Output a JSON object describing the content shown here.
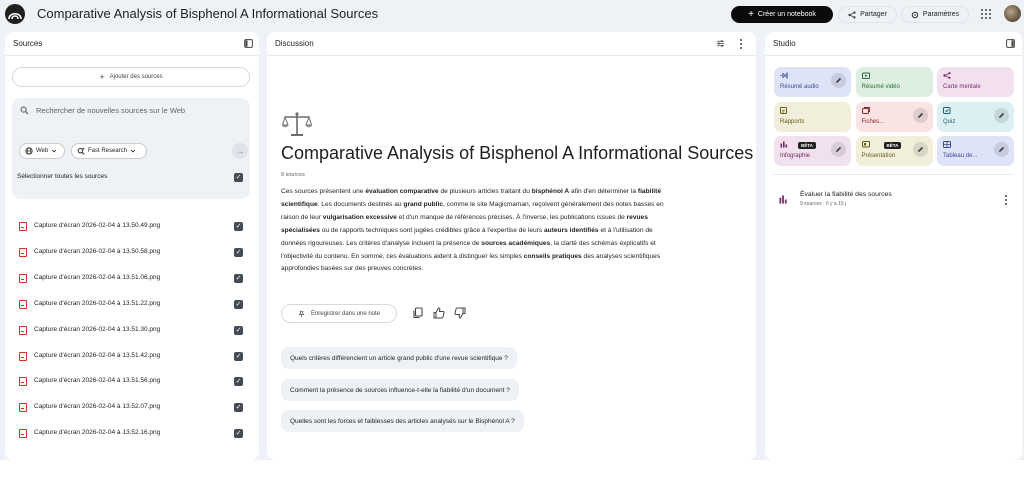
{
  "header": {
    "title": "Comparative Analysis of Bisphenol A Informational Sources",
    "create_label": "Créer un notebook",
    "share_label": "Partager",
    "settings_label": "Paramètres"
  },
  "sources": {
    "title": "Sources",
    "add_label": "Ajouter des sources",
    "search_placeholder": "Rechercher de nouvelles sources sur le Web",
    "chip_web": "Web",
    "chip_research": "Fast Research",
    "select_all_label": "Sélectionner toutes les sources",
    "items": [
      {
        "name": "Capture d'écran 2026-02-04 à 13.50.49.png",
        "checked": true
      },
      {
        "name": "Capture d'écran 2026-02-04 à 13.50.58.png",
        "checked": true
      },
      {
        "name": "Capture d'écran 2026-02-04 à 13.51.06.png",
        "checked": true
      },
      {
        "name": "Capture d'écran 2026-02-04 à 13.51.22.png",
        "checked": true
      },
      {
        "name": "Capture d'écran 2026-02-04 à 13.51.30.png",
        "checked": true
      },
      {
        "name": "Capture d'écran 2026-02-04 à 13.51.42.png",
        "checked": true
      },
      {
        "name": "Capture d'écran 2026-02-04 à 13.51.56.png",
        "checked": true
      },
      {
        "name": "Capture d'écran 2026-02-04 à 13.52.07.png",
        "checked": true
      },
      {
        "name": "Capture d'écran 2026-02-04 à 13.52.16.png",
        "checked": true
      }
    ]
  },
  "discussion": {
    "title": "Discussion",
    "doc_title": "Comparative Analysis of Bisphenol A Informational Sources",
    "source_count": "9 sources",
    "summary_segments": [
      {
        "text": "Ces sources présentent une ",
        "bold": false
      },
      {
        "text": "évaluation comparative",
        "bold": true
      },
      {
        "text": " de plusieurs articles traitant du ",
        "bold": false
      },
      {
        "text": "bisphénol A",
        "bold": true
      },
      {
        "text": " afin d'en déterminer la ",
        "bold": false
      },
      {
        "text": "fiabilité scientifique",
        "bold": true
      },
      {
        "text": ". Les documents destinés au ",
        "bold": false
      },
      {
        "text": "grand public",
        "bold": true
      },
      {
        "text": ", comme le site Magicmaman, reçoivent généralement des notes basses en raison de leur ",
        "bold": false
      },
      {
        "text": "vulgarisation excessive",
        "bold": true
      },
      {
        "text": " et d'un manque de références précises. À l'inverse, les publications issues de ",
        "bold": false
      },
      {
        "text": "revues spécialisées",
        "bold": true
      },
      {
        "text": " ou de rapports techniques sont jugées crédibles grâce à l'expertise de leurs ",
        "bold": false
      },
      {
        "text": "auteurs identifiés",
        "bold": true
      },
      {
        "text": " et à l'utilisation de données rigoureuses. Les critères d'analyse incluent la présence de ",
        "bold": false
      },
      {
        "text": "sources académiques",
        "bold": true
      },
      {
        "text": ", la clarté des schémas explicatifs et l'objectivité du contenu. En somme, ces évaluations aident à distinguer les simples ",
        "bold": false
      },
      {
        "text": "conseils pratiques",
        "bold": true
      },
      {
        "text": " des analyses scientifiques approfondies basées sur des preuves concrètes.",
        "bold": false
      }
    ],
    "save_note_label": "Enregistrer dans une note",
    "suggestions": [
      "Quels critères différencient un article grand public d'une revue scientifique ?",
      "Comment la présence de sources influence-t-elle la fiabilité d'un document ?",
      "Quelles sont les forces et faiblesses des articles analysés sur le Bisphénol A ?"
    ]
  },
  "studio": {
    "title": "Studio",
    "tiles": [
      {
        "label": "Résumé audio",
        "bg": "#dfe3f7",
        "fg": "#3b4a9c",
        "icon": "waveform-icon",
        "edit": true,
        "beta": false
      },
      {
        "label": "Résumé vidéo",
        "bg": "#dcefe0",
        "fg": "#2e6b3a",
        "icon": "video-icon",
        "edit": false,
        "beta": false
      },
      {
        "label": "Carte mentale",
        "bg": "#f2e0ee",
        "fg": "#7a2f6a",
        "icon": "mindmap-icon",
        "edit": false,
        "beta": false
      },
      {
        "label": "Rapports",
        "bg": "#f1eedc",
        "fg": "#6b5a14",
        "icon": "report-icon",
        "edit": false,
        "beta": false
      },
      {
        "label": "Fiches...",
        "bg": "#f9e3e3",
        "fg": "#8c2a2a",
        "icon": "flashcard-icon",
        "edit": true,
        "beta": false
      },
      {
        "label": "Quiz",
        "bg": "#dceff3",
        "fg": "#1f5f73",
        "icon": "quiz-icon",
        "edit": true,
        "beta": false
      },
      {
        "label": "Infographie",
        "bg": "#f1e1ef",
        "fg": "#6d2a60",
        "icon": "infographic-icon",
        "edit": true,
        "beta": true,
        "beta_label": "BÊTA"
      },
      {
        "label": "Présentation",
        "bg": "#f1eedc",
        "fg": "#6b5a14",
        "icon": "slides-icon",
        "edit": true,
        "beta": true,
        "beta_label": "BÊTA"
      },
      {
        "label": "Tableau de...",
        "bg": "#dfe3f7",
        "fg": "#3b4a9c",
        "icon": "table-icon",
        "edit": true,
        "beta": false
      }
    ],
    "note": {
      "title": "Évaluer la fiabilité des sources",
      "meta": "9 sources · Il y a 15 j"
    }
  }
}
